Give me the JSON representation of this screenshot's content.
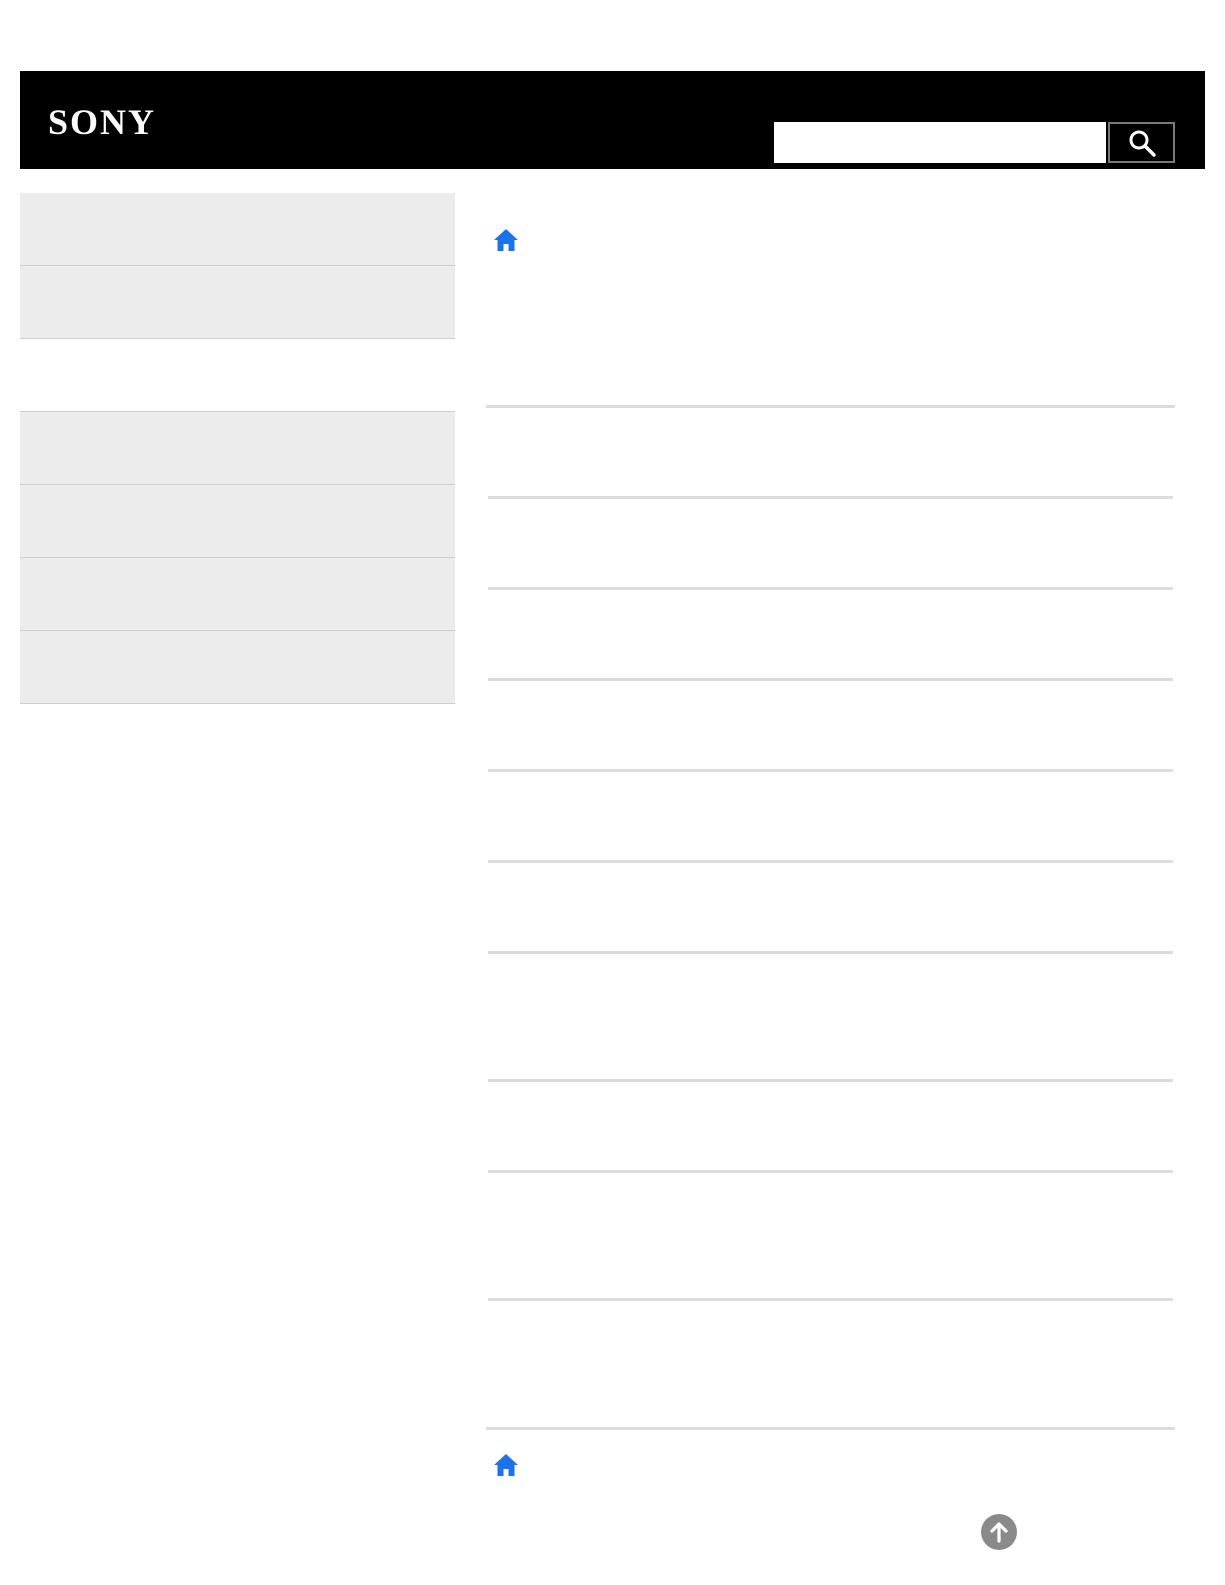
{
  "brand": {
    "logo_text": "SONY"
  },
  "search": {
    "placeholder": "",
    "value": ""
  },
  "sidebar": {
    "items": [
      {
        "label": ""
      },
      {
        "label": ""
      },
      {
        "label": ""
      },
      {
        "label": ""
      },
      {
        "label": ""
      },
      {
        "label": ""
      },
      {
        "label": ""
      }
    ]
  },
  "icons": {
    "home": "home-icon",
    "search": "search-icon",
    "back_to_top": "arrow-up-circle-icon"
  },
  "colors": {
    "header_bg": "#000000",
    "sidebar_bg": "#ececec",
    "link_blue": "#1a73e8",
    "to_top_bg": "#8a8a8a"
  }
}
